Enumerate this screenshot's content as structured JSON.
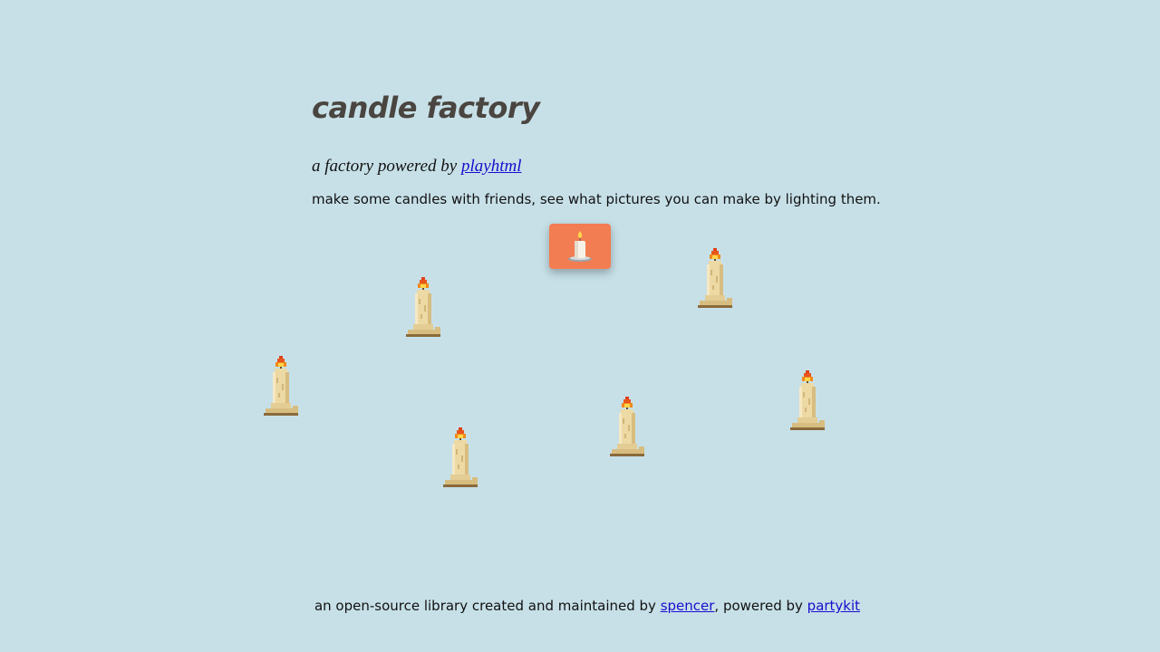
{
  "page": {
    "title": "candle factory",
    "subtitle_prefix": "a factory powered by ",
    "subtitle_link": "playhtml",
    "description": "make some candles with friends, see what pictures you can make by lighting them."
  },
  "make_button": {
    "icon": "candle-icon",
    "color": "#f27d52"
  },
  "candles": [
    {
      "lit": true
    },
    {
      "lit": true
    },
    {
      "lit": true
    },
    {
      "lit": true
    },
    {
      "lit": true
    },
    {
      "lit": true
    },
    {
      "lit": true
    }
  ],
  "footer": {
    "text_before": "an open-source library created and maintained by ",
    "author_link": "spencer",
    "text_middle": ", powered by ",
    "platform_link": "partykit"
  },
  "colors": {
    "background": "#c7e0e8",
    "title": "#4a4540",
    "link": "#1a0dcc",
    "wax": "#ecd9a4",
    "flame": "#f08a1c"
  }
}
